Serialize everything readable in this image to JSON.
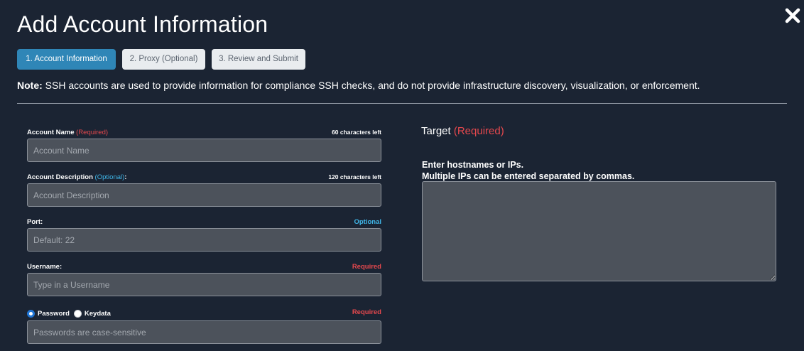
{
  "dialog": {
    "title": "Add Account Information",
    "close_icon": "close-icon"
  },
  "steps": [
    {
      "label": "1. Account Information",
      "active": true
    },
    {
      "label": "2. Proxy (Optional)",
      "active": false
    },
    {
      "label": "3. Review and Submit",
      "active": false
    }
  ],
  "note": {
    "prefix": "Note:",
    "text": " SSH accounts are used to provide information for compliance SSH checks, and do not provide infrastructure discovery, visualization, or enforcement."
  },
  "form": {
    "account_name": {
      "label": "Account Name ",
      "tag": "(Required)",
      "counter": "60 characters left",
      "placeholder": "Account Name"
    },
    "account_description": {
      "label": "Account Description ",
      "tag": "(Optional)",
      "suffix": ":",
      "counter": "120 characters left",
      "placeholder": "Account Description"
    },
    "port": {
      "label": "Port:",
      "hint": "Optional",
      "placeholder": "Default: 22"
    },
    "username": {
      "label": "Username:",
      "hint": "Required",
      "placeholder": "Type in a Username"
    },
    "auth": {
      "options": [
        {
          "label": "Password",
          "selected": true
        },
        {
          "label": "Keydata",
          "selected": false
        }
      ],
      "hint": "Required",
      "placeholder": "Passwords are case-sensitive"
    }
  },
  "target": {
    "title": "Target ",
    "tag": "(Required)",
    "instruction_1": "Enter hostnames or IPs.",
    "instruction_2": "Multiple IPs can be entered separated by commas."
  },
  "colors": {
    "background": "#1b2433",
    "active_step": "#2f86b7",
    "required": "#e5484d",
    "optional": "#3fb6e8",
    "input_bg": "#4c525b"
  }
}
